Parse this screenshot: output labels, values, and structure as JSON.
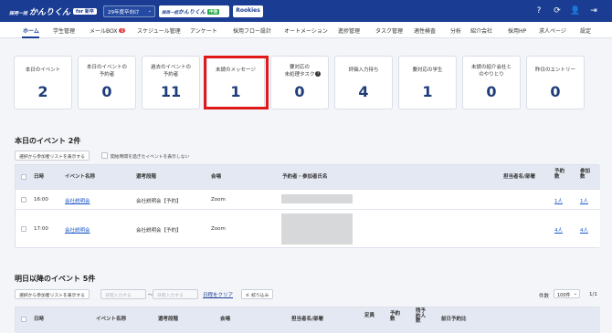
{
  "header": {
    "logo_prefix": "採用一括",
    "logo_main": "かんりくん",
    "logo_for": "for 新卒",
    "year_select": "29年度卒向け",
    "product_link_1": {
      "prefix": "採用一括",
      "main": "かんりくん",
      "tag": "中途"
    },
    "product_link_2": "Rookies",
    "icons": [
      "help-icon",
      "sync-icon",
      "user-icon",
      "logout-icon"
    ]
  },
  "nav": {
    "items": [
      "ホーム",
      "学生管理",
      "メールBOX",
      "スケジュール管理",
      "アンケート",
      "採用フロー設計",
      "オートメーション",
      "進捗管理",
      "タスク管理",
      "適性検査",
      "分析",
      "紹介会社",
      "採用HP",
      "求人ページ",
      "設定"
    ],
    "active": "ホーム",
    "mail_badge": "6"
  },
  "summary_cards": [
    {
      "label": "本日のイベント",
      "value": "2"
    },
    {
      "label": "本日のイベントの\n予約者",
      "value": "0"
    },
    {
      "label": "過去のイベントの\n予約者",
      "value": "11"
    },
    {
      "label": "未読のメッセージ",
      "value": "1"
    },
    {
      "label": "要対応の\n未処理タスク",
      "value": "0"
    },
    {
      "label": "評価入力待ち",
      "value": "4"
    },
    {
      "label": "要対応の学生",
      "value": "1"
    },
    {
      "label": "未読の紹介会社と\nのやりとり",
      "value": "0"
    },
    {
      "label": "昨日のエントリー",
      "value": "0"
    }
  ],
  "today_events": {
    "title": "本日のイベント 2件",
    "btn_show_list": "選択から参加者リストを表示する",
    "checkbox_label": "開始時間を過ぎたイベントを表示しない",
    "columns": [
      "日時",
      "イベント名称",
      "選考段階",
      "会場",
      "予約者・参加者氏名",
      "担当者名/部署",
      "予約数",
      "参加数"
    ],
    "rows": [
      {
        "time": "16:00",
        "name": "会社説明会",
        "stage": "会社説明会【予約】",
        "venue": "Zoom",
        "reserved": "1人",
        "attended": "1人"
      },
      {
        "time": "17:00",
        "name": "会社説明会",
        "stage": "会社説明会【予約】",
        "venue": "Zoom",
        "reserved": "4人",
        "attended": "4人"
      }
    ]
  },
  "future_events": {
    "title": "明日以降のイベント 5件",
    "btn_show_list": "選択から参加者リストを表示する",
    "date_from_placeholder": "日程入力する",
    "date_sep": "〜",
    "date_to_placeholder": "日程入力する",
    "clear_label": "日程をクリア",
    "filter_label": "絞り込み",
    "per_page_label": "件数",
    "per_page_value": "100件",
    "page_info": "1/1",
    "columns": [
      "日時",
      "イベント名称",
      "選考段階",
      "会場",
      "担当者名/部署",
      "定員",
      "予約数",
      "残予約人数",
      "前日予約比"
    ]
  }
}
